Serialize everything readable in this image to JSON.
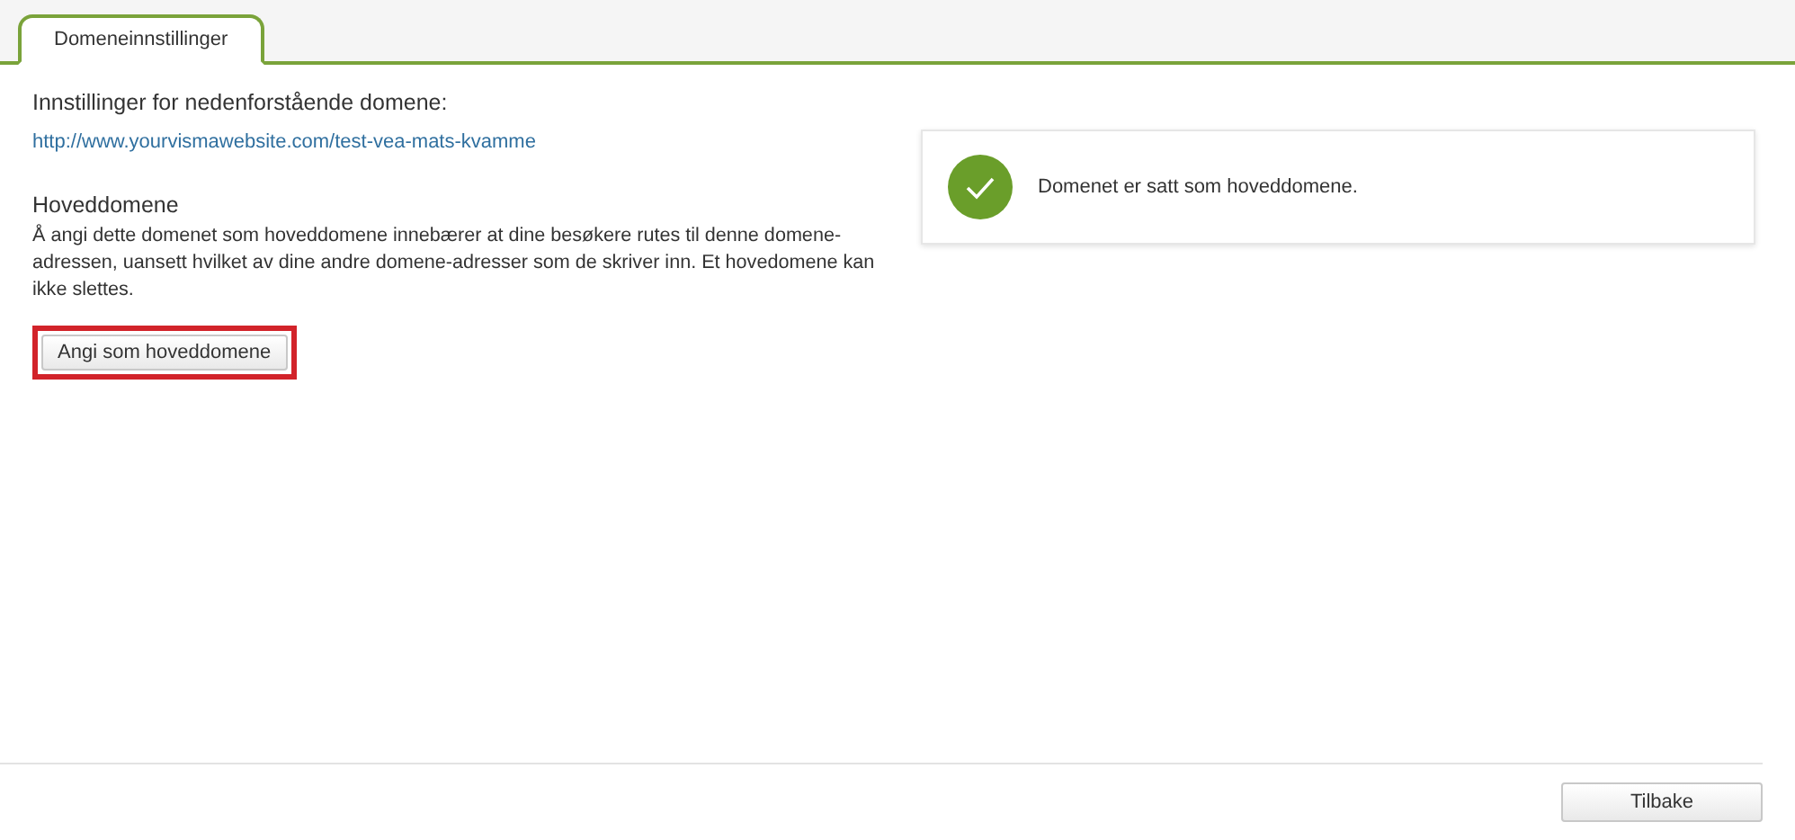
{
  "tabs": [
    {
      "label": "Domeneinnstillinger",
      "selected": true
    }
  ],
  "settings": {
    "heading": "Innstillinger for nedenforstående domene:",
    "url": "http://www.yourvismawebsite.com/test-vea-mats-kvamme",
    "section_title": "Hoveddomene",
    "description": "Å angi dette domenet som hoveddomene innebærer at dine besøkere rutes til denne domene-adressen, uansett hvilket av dine andre domene-adresser som de skriver inn. Et hovedomene kan ikke slettes.",
    "button": {
      "label": "Angi som hoveddomene",
      "highlighted": true
    }
  },
  "notice": {
    "kind": "success",
    "message": "Domenet er satt som hoveddomene."
  },
  "footer": {
    "button": "Tilbake"
  }
}
